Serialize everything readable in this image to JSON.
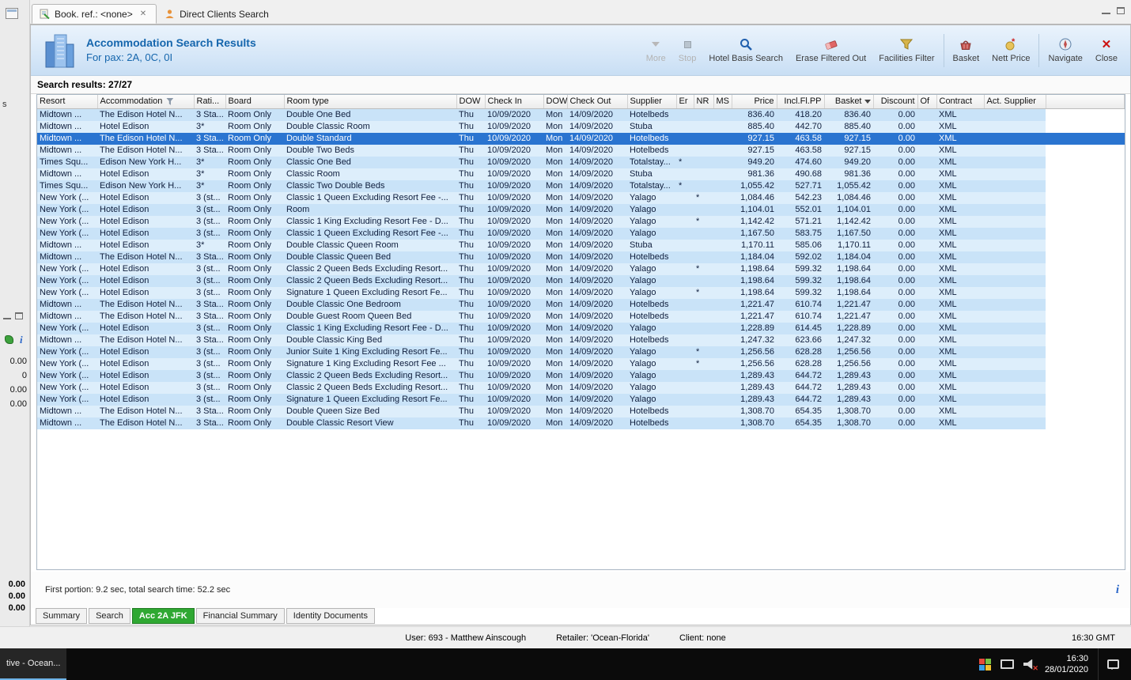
{
  "icons": {
    "info": "i",
    "tab_close": "✕",
    "close": "✕"
  },
  "tab_bar": {
    "tabs": [
      {
        "label": "Book. ref.: <none>"
      },
      {
        "label": "Direct Clients Search"
      }
    ]
  },
  "header": {
    "title": "Accommodation Search Results",
    "subtitle": "For pax: 2A, 0C, 0I",
    "toolbar": [
      {
        "label": "More"
      },
      {
        "label": "Stop"
      },
      {
        "label": "Hotel Basis Search"
      },
      {
        "label": "Erase Filtered Out"
      },
      {
        "label": "Facilities Filter"
      },
      {
        "label": "Basket"
      },
      {
        "label": "Nett Price"
      },
      {
        "label": "Navigate"
      },
      {
        "label": "Close"
      }
    ]
  },
  "results": {
    "summary": "Search results: 27/27",
    "footer": "First portion: 9.2 sec, total search time: 52.2 sec",
    "selected_index": 2,
    "columns": [
      {
        "key": "resort",
        "label": "Resort"
      },
      {
        "key": "accommodation",
        "label": "Accommodation",
        "icon": "filter"
      },
      {
        "key": "rating",
        "label": "Rati..."
      },
      {
        "key": "board",
        "label": "Board"
      },
      {
        "key": "room_type",
        "label": "Room type"
      },
      {
        "key": "dow_in",
        "label": "DOW"
      },
      {
        "key": "check_in",
        "label": "Check In"
      },
      {
        "key": "dow_out",
        "label": "DOW"
      },
      {
        "key": "check_out",
        "label": "Check Out"
      },
      {
        "key": "supplier",
        "label": "Supplier"
      },
      {
        "key": "er",
        "label": "Er"
      },
      {
        "key": "nr",
        "label": "NR"
      },
      {
        "key": "ms",
        "label": "MS"
      },
      {
        "key": "price",
        "label": "Price",
        "align": "right"
      },
      {
        "key": "incl_fl_pp",
        "label": "Incl.Fl.PP",
        "align": "right"
      },
      {
        "key": "basket",
        "label": "Basket",
        "align": "right",
        "icon": "dropdown"
      },
      {
        "key": "discount",
        "label": "Discount",
        "align": "right"
      },
      {
        "key": "of",
        "label": "Of"
      },
      {
        "key": "contract",
        "label": "Contract"
      },
      {
        "key": "act_supplier",
        "label": "Act. Supplier"
      }
    ],
    "rows": [
      {
        "resort": "Midtown ...",
        "accommodation": "The Edison Hotel N...",
        "rating": "3 Sta...",
        "board": "Room Only",
        "room_type": "Double One Bed",
        "dow_in": "Thu",
        "check_in": "10/09/2020",
        "dow_out": "Mon",
        "check_out": "14/09/2020",
        "supplier": "Hotelbeds",
        "er": "",
        "nr": "",
        "ms": "",
        "price": "836.40",
        "incl_fl_pp": "418.20",
        "basket": "836.40",
        "discount": "0.00",
        "of": "",
        "contract": "XML",
        "act_supplier": ""
      },
      {
        "resort": "Midtown ...",
        "accommodation": "Hotel Edison",
        "rating": "3*",
        "board": "Room Only",
        "room_type": "Double Classic Room",
        "dow_in": "Thu",
        "check_in": "10/09/2020",
        "dow_out": "Mon",
        "check_out": "14/09/2020",
        "supplier": "Stuba",
        "er": "",
        "nr": "",
        "ms": "",
        "price": "885.40",
        "incl_fl_pp": "442.70",
        "basket": "885.40",
        "discount": "0.00",
        "of": "",
        "contract": "XML",
        "act_supplier": ""
      },
      {
        "resort": "Midtown ...",
        "accommodation": "The Edison Hotel N...",
        "rating": "3 Sta...",
        "board": "Room Only",
        "room_type": "Double Standard",
        "dow_in": "Thu",
        "check_in": "10/09/2020",
        "dow_out": "Mon",
        "check_out": "14/09/2020",
        "supplier": "Hotelbeds",
        "er": "",
        "nr": "",
        "ms": "",
        "price": "927.15",
        "incl_fl_pp": "463.58",
        "basket": "927.15",
        "discount": "0.00",
        "of": "",
        "contract": "XML",
        "act_supplier": ""
      },
      {
        "resort": "Midtown ...",
        "accommodation": "The Edison Hotel N...",
        "rating": "3 Sta...",
        "board": "Room Only",
        "room_type": "Double Two Beds",
        "dow_in": "Thu",
        "check_in": "10/09/2020",
        "dow_out": "Mon",
        "check_out": "14/09/2020",
        "supplier": "Hotelbeds",
        "er": "",
        "nr": "",
        "ms": "",
        "price": "927.15",
        "incl_fl_pp": "463.58",
        "basket": "927.15",
        "discount": "0.00",
        "of": "",
        "contract": "XML",
        "act_supplier": ""
      },
      {
        "resort": "Times Squ...",
        "accommodation": "Edison New York H...",
        "rating": "3*",
        "board": "Room Only",
        "room_type": "Classic One Bed",
        "dow_in": "Thu",
        "check_in": "10/09/2020",
        "dow_out": "Mon",
        "check_out": "14/09/2020",
        "supplier": "Totalstay...",
        "er": "*",
        "nr": "",
        "ms": "",
        "price": "949.20",
        "incl_fl_pp": "474.60",
        "basket": "949.20",
        "discount": "0.00",
        "of": "",
        "contract": "XML",
        "act_supplier": ""
      },
      {
        "resort": "Midtown ...",
        "accommodation": "Hotel Edison",
        "rating": "3*",
        "board": "Room Only",
        "room_type": "Classic Room",
        "dow_in": "Thu",
        "check_in": "10/09/2020",
        "dow_out": "Mon",
        "check_out": "14/09/2020",
        "supplier": "Stuba",
        "er": "",
        "nr": "",
        "ms": "",
        "price": "981.36",
        "incl_fl_pp": "490.68",
        "basket": "981.36",
        "discount": "0.00",
        "of": "",
        "contract": "XML",
        "act_supplier": ""
      },
      {
        "resort": "Times Squ...",
        "accommodation": "Edison New York H...",
        "rating": "3*",
        "board": "Room Only",
        "room_type": "Classic Two Double Beds",
        "dow_in": "Thu",
        "check_in": "10/09/2020",
        "dow_out": "Mon",
        "check_out": "14/09/2020",
        "supplier": "Totalstay...",
        "er": "*",
        "nr": "",
        "ms": "",
        "price": "1,055.42",
        "incl_fl_pp": "527.71",
        "basket": "1,055.42",
        "discount": "0.00",
        "of": "",
        "contract": "XML",
        "act_supplier": ""
      },
      {
        "resort": "New York (...",
        "accommodation": "Hotel Edison",
        "rating": "3 (st...",
        "board": "Room Only",
        "room_type": "Classic 1 Queen Excluding Resort Fee -...",
        "dow_in": "Thu",
        "check_in": "10/09/2020",
        "dow_out": "Mon",
        "check_out": "14/09/2020",
        "supplier": "Yalago",
        "er": "",
        "nr": "*",
        "ms": "",
        "price": "1,084.46",
        "incl_fl_pp": "542.23",
        "basket": "1,084.46",
        "discount": "0.00",
        "of": "",
        "contract": "XML",
        "act_supplier": ""
      },
      {
        "resort": "New York (...",
        "accommodation": "Hotel Edison",
        "rating": "3 (st...",
        "board": "Room Only",
        "room_type": "Room",
        "dow_in": "Thu",
        "check_in": "10/09/2020",
        "dow_out": "Mon",
        "check_out": "14/09/2020",
        "supplier": "Yalago",
        "er": "",
        "nr": "",
        "ms": "",
        "price": "1,104.01",
        "incl_fl_pp": "552.01",
        "basket": "1,104.01",
        "discount": "0.00",
        "of": "",
        "contract": "XML",
        "act_supplier": ""
      },
      {
        "resort": "New York (...",
        "accommodation": "Hotel Edison",
        "rating": "3 (st...",
        "board": "Room Only",
        "room_type": "Classic 1 King Excluding Resort Fee - D...",
        "dow_in": "Thu",
        "check_in": "10/09/2020",
        "dow_out": "Mon",
        "check_out": "14/09/2020",
        "supplier": "Yalago",
        "er": "",
        "nr": "*",
        "ms": "",
        "price": "1,142.42",
        "incl_fl_pp": "571.21",
        "basket": "1,142.42",
        "discount": "0.00",
        "of": "",
        "contract": "XML",
        "act_supplier": ""
      },
      {
        "resort": "New York (...",
        "accommodation": "Hotel Edison",
        "rating": "3 (st...",
        "board": "Room Only",
        "room_type": "Classic 1 Queen Excluding Resort Fee -...",
        "dow_in": "Thu",
        "check_in": "10/09/2020",
        "dow_out": "Mon",
        "check_out": "14/09/2020",
        "supplier": "Yalago",
        "er": "",
        "nr": "",
        "ms": "",
        "price": "1,167.50",
        "incl_fl_pp": "583.75",
        "basket": "1,167.50",
        "discount": "0.00",
        "of": "",
        "contract": "XML",
        "act_supplier": ""
      },
      {
        "resort": "Midtown ...",
        "accommodation": "Hotel Edison",
        "rating": "3*",
        "board": "Room Only",
        "room_type": "Double Classic Queen Room",
        "dow_in": "Thu",
        "check_in": "10/09/2020",
        "dow_out": "Mon",
        "check_out": "14/09/2020",
        "supplier": "Stuba",
        "er": "",
        "nr": "",
        "ms": "",
        "price": "1,170.11",
        "incl_fl_pp": "585.06",
        "basket": "1,170.11",
        "discount": "0.00",
        "of": "",
        "contract": "XML",
        "act_supplier": ""
      },
      {
        "resort": "Midtown ...",
        "accommodation": "The Edison Hotel N...",
        "rating": "3 Sta...",
        "board": "Room Only",
        "room_type": "Double Classic Queen Bed",
        "dow_in": "Thu",
        "check_in": "10/09/2020",
        "dow_out": "Mon",
        "check_out": "14/09/2020",
        "supplier": "Hotelbeds",
        "er": "",
        "nr": "",
        "ms": "",
        "price": "1,184.04",
        "incl_fl_pp": "592.02",
        "basket": "1,184.04",
        "discount": "0.00",
        "of": "",
        "contract": "XML",
        "act_supplier": ""
      },
      {
        "resort": "New York (...",
        "accommodation": "Hotel Edison",
        "rating": "3 (st...",
        "board": "Room Only",
        "room_type": "Classic 2 Queen Beds Excluding Resort...",
        "dow_in": "Thu",
        "check_in": "10/09/2020",
        "dow_out": "Mon",
        "check_out": "14/09/2020",
        "supplier": "Yalago",
        "er": "",
        "nr": "*",
        "ms": "",
        "price": "1,198.64",
        "incl_fl_pp": "599.32",
        "basket": "1,198.64",
        "discount": "0.00",
        "of": "",
        "contract": "XML",
        "act_supplier": ""
      },
      {
        "resort": "New York (...",
        "accommodation": "Hotel Edison",
        "rating": "3 (st...",
        "board": "Room Only",
        "room_type": "Classic 2 Queen Beds Excluding Resort...",
        "dow_in": "Thu",
        "check_in": "10/09/2020",
        "dow_out": "Mon",
        "check_out": "14/09/2020",
        "supplier": "Yalago",
        "er": "",
        "nr": "",
        "ms": "",
        "price": "1,198.64",
        "incl_fl_pp": "599.32",
        "basket": "1,198.64",
        "discount": "0.00",
        "of": "",
        "contract": "XML",
        "act_supplier": ""
      },
      {
        "resort": "New York (...",
        "accommodation": "Hotel Edison",
        "rating": "3 (st...",
        "board": "Room Only",
        "room_type": "Signature 1 Queen Excluding Resort Fe...",
        "dow_in": "Thu",
        "check_in": "10/09/2020",
        "dow_out": "Mon",
        "check_out": "14/09/2020",
        "supplier": "Yalago",
        "er": "",
        "nr": "*",
        "ms": "",
        "price": "1,198.64",
        "incl_fl_pp": "599.32",
        "basket": "1,198.64",
        "discount": "0.00",
        "of": "",
        "contract": "XML",
        "act_supplier": ""
      },
      {
        "resort": "Midtown ...",
        "accommodation": "The Edison Hotel N...",
        "rating": "3 Sta...",
        "board": "Room Only",
        "room_type": "Double Classic One Bedroom",
        "dow_in": "Thu",
        "check_in": "10/09/2020",
        "dow_out": "Mon",
        "check_out": "14/09/2020",
        "supplier": "Hotelbeds",
        "er": "",
        "nr": "",
        "ms": "",
        "price": "1,221.47",
        "incl_fl_pp": "610.74",
        "basket": "1,221.47",
        "discount": "0.00",
        "of": "",
        "contract": "XML",
        "act_supplier": ""
      },
      {
        "resort": "Midtown ...",
        "accommodation": "The Edison Hotel N...",
        "rating": "3 Sta...",
        "board": "Room Only",
        "room_type": "Double Guest Room Queen Bed",
        "dow_in": "Thu",
        "check_in": "10/09/2020",
        "dow_out": "Mon",
        "check_out": "14/09/2020",
        "supplier": "Hotelbeds",
        "er": "",
        "nr": "",
        "ms": "",
        "price": "1,221.47",
        "incl_fl_pp": "610.74",
        "basket": "1,221.47",
        "discount": "0.00",
        "of": "",
        "contract": "XML",
        "act_supplier": ""
      },
      {
        "resort": "New York (...",
        "accommodation": "Hotel Edison",
        "rating": "3 (st...",
        "board": "Room Only",
        "room_type": "Classic 1 King Excluding Resort Fee - D...",
        "dow_in": "Thu",
        "check_in": "10/09/2020",
        "dow_out": "Mon",
        "check_out": "14/09/2020",
        "supplier": "Yalago",
        "er": "",
        "nr": "",
        "ms": "",
        "price": "1,228.89",
        "incl_fl_pp": "614.45",
        "basket": "1,228.89",
        "discount": "0.00",
        "of": "",
        "contract": "XML",
        "act_supplier": ""
      },
      {
        "resort": "Midtown ...",
        "accommodation": "The Edison Hotel N...",
        "rating": "3 Sta...",
        "board": "Room Only",
        "room_type": "Double Classic King Bed",
        "dow_in": "Thu",
        "check_in": "10/09/2020",
        "dow_out": "Mon",
        "check_out": "14/09/2020",
        "supplier": "Hotelbeds",
        "er": "",
        "nr": "",
        "ms": "",
        "price": "1,247.32",
        "incl_fl_pp": "623.66",
        "basket": "1,247.32",
        "discount": "0.00",
        "of": "",
        "contract": "XML",
        "act_supplier": ""
      },
      {
        "resort": "New York (...",
        "accommodation": "Hotel Edison",
        "rating": "3 (st...",
        "board": "Room Only",
        "room_type": "Junior Suite 1 King Excluding Resort Fe...",
        "dow_in": "Thu",
        "check_in": "10/09/2020",
        "dow_out": "Mon",
        "check_out": "14/09/2020",
        "supplier": "Yalago",
        "er": "",
        "nr": "*",
        "ms": "",
        "price": "1,256.56",
        "incl_fl_pp": "628.28",
        "basket": "1,256.56",
        "discount": "0.00",
        "of": "",
        "contract": "XML",
        "act_supplier": ""
      },
      {
        "resort": "New York (...",
        "accommodation": "Hotel Edison",
        "rating": "3 (st...",
        "board": "Room Only",
        "room_type": "Signature 1 King Excluding Resort Fee ...",
        "dow_in": "Thu",
        "check_in": "10/09/2020",
        "dow_out": "Mon",
        "check_out": "14/09/2020",
        "supplier": "Yalago",
        "er": "",
        "nr": "*",
        "ms": "",
        "price": "1,256.56",
        "incl_fl_pp": "628.28",
        "basket": "1,256.56",
        "discount": "0.00",
        "of": "",
        "contract": "XML",
        "act_supplier": ""
      },
      {
        "resort": "New York (...",
        "accommodation": "Hotel Edison",
        "rating": "3 (st...",
        "board": "Room Only",
        "room_type": "Classic 2 Queen Beds Excluding Resort...",
        "dow_in": "Thu",
        "check_in": "10/09/2020",
        "dow_out": "Mon",
        "check_out": "14/09/2020",
        "supplier": "Yalago",
        "er": "",
        "nr": "",
        "ms": "",
        "price": "1,289.43",
        "incl_fl_pp": "644.72",
        "basket": "1,289.43",
        "discount": "0.00",
        "of": "",
        "contract": "XML",
        "act_supplier": ""
      },
      {
        "resort": "New York (...",
        "accommodation": "Hotel Edison",
        "rating": "3 (st...",
        "board": "Room Only",
        "room_type": "Classic 2 Queen Beds Excluding Resort...",
        "dow_in": "Thu",
        "check_in": "10/09/2020",
        "dow_out": "Mon",
        "check_out": "14/09/2020",
        "supplier": "Yalago",
        "er": "",
        "nr": "",
        "ms": "",
        "price": "1,289.43",
        "incl_fl_pp": "644.72",
        "basket": "1,289.43",
        "discount": "0.00",
        "of": "",
        "contract": "XML",
        "act_supplier": ""
      },
      {
        "resort": "New York (...",
        "accommodation": "Hotel Edison",
        "rating": "3 (st...",
        "board": "Room Only",
        "room_type": "Signature 1 Queen Excluding Resort Fe...",
        "dow_in": "Thu",
        "check_in": "10/09/2020",
        "dow_out": "Mon",
        "check_out": "14/09/2020",
        "supplier": "Yalago",
        "er": "",
        "nr": "",
        "ms": "",
        "price": "1,289.43",
        "incl_fl_pp": "644.72",
        "basket": "1,289.43",
        "discount": "0.00",
        "of": "",
        "contract": "XML",
        "act_supplier": ""
      },
      {
        "resort": "Midtown ...",
        "accommodation": "The Edison Hotel N...",
        "rating": "3 Sta...",
        "board": "Room Only",
        "room_type": "Double Queen Size Bed",
        "dow_in": "Thu",
        "check_in": "10/09/2020",
        "dow_out": "Mon",
        "check_out": "14/09/2020",
        "supplier": "Hotelbeds",
        "er": "",
        "nr": "",
        "ms": "",
        "price": "1,308.70",
        "incl_fl_pp": "654.35",
        "basket": "1,308.70",
        "discount": "0.00",
        "of": "",
        "contract": "XML",
        "act_supplier": ""
      },
      {
        "resort": "Midtown ...",
        "accommodation": "The Edison Hotel N...",
        "rating": "3 Sta...",
        "board": "Room Only",
        "room_type": "Double Classic Resort View",
        "dow_in": "Thu",
        "check_in": "10/09/2020",
        "dow_out": "Mon",
        "check_out": "14/09/2020",
        "supplier": "Hotelbeds",
        "er": "",
        "nr": "",
        "ms": "",
        "price": "1,308.70",
        "incl_fl_pp": "654.35",
        "basket": "1,308.70",
        "discount": "0.00",
        "of": "",
        "contract": "XML",
        "act_supplier": ""
      }
    ]
  },
  "bottom_tabs": [
    {
      "label": "Summary"
    },
    {
      "label": "Search"
    },
    {
      "label": "Acc 2A JFK"
    },
    {
      "label": "Financial Summary"
    },
    {
      "label": "Identity Documents"
    }
  ],
  "status_bar": {
    "user": "User: 693 - Matthew Ainscough",
    "retailer": "Retailer: 'Ocean-Florida'",
    "client": "Client: none",
    "time": "16:30 GMT"
  },
  "taskbar": {
    "app_button": "tive - Ocean...",
    "time": "16:30",
    "date": "28/01/2020"
  },
  "side_panel": {
    "partial_label": "s",
    "values": [
      "0.00",
      "0",
      "0.00",
      "0.00"
    ],
    "totals": [
      "0.00",
      "0.00",
      "0.00"
    ]
  }
}
